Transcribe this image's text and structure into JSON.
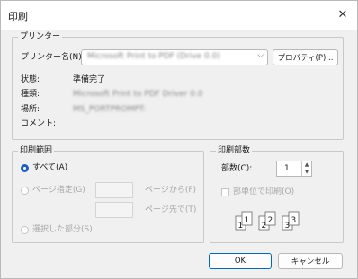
{
  "dialog": {
    "title": "印刷",
    "printer_group": {
      "legend": "プリンター",
      "name_label": "プリンター名(N):",
      "name_value": "Microsoft Print to PDF (Drive 0.0)",
      "properties_button": "プロパティ(P)...",
      "status_label": "状態:",
      "status_value": "準備完了",
      "type_label": "種類:",
      "type_value": "Microsoft Print to PDF Driver 0.0",
      "where_label": "場所:",
      "where_value": "MS_PORTPROMPT:",
      "comment_label": "コメント:"
    },
    "range_group": {
      "legend": "印刷範囲",
      "all_label": "すべて(A)",
      "pages_label": "ページ指定(G)",
      "from_label": "ページから(F)",
      "to_label": "ページ先で(T)",
      "selection_label": "選択した部分(S)",
      "selected": "all"
    },
    "copies_group": {
      "legend": "印刷部数",
      "copies_label": "部数(C):",
      "copies_value": "1",
      "collate_label": "部単位で印刷(O)",
      "collate_checked": false
    },
    "ok_button": "OK",
    "cancel_button": "キャンセル",
    "icons": {
      "close": "close-icon",
      "dropdown": "chevron-down-icon"
    },
    "colors": {
      "accent": "#1f5fbf",
      "ok_border": "#0067c0"
    }
  }
}
